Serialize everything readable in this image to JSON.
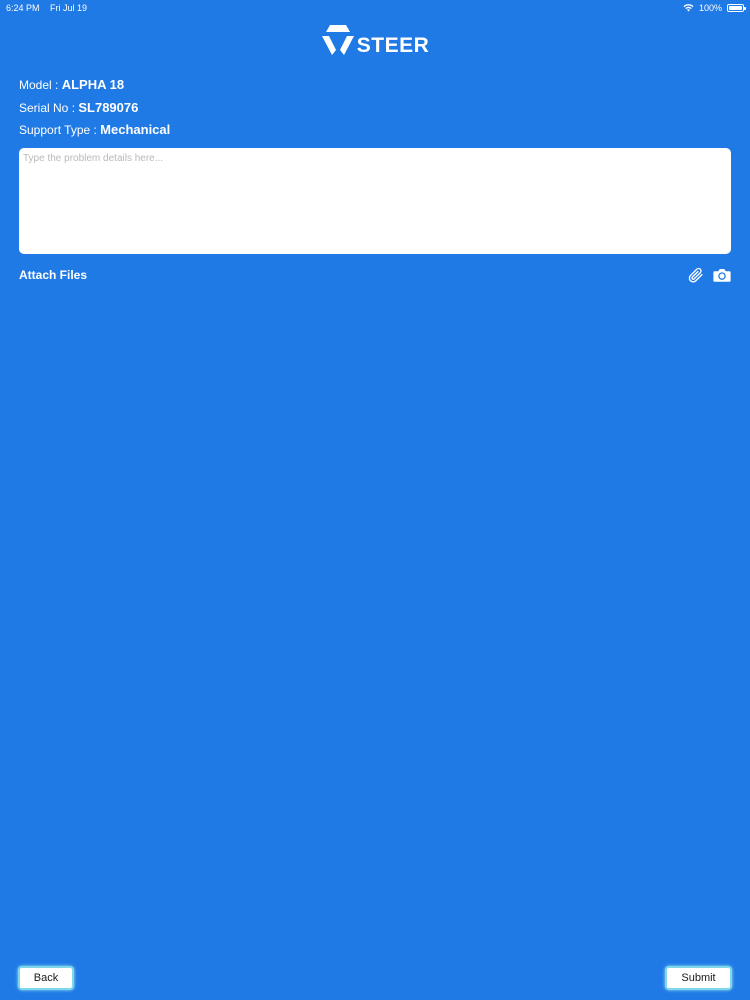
{
  "status_bar": {
    "time": "6:24 PM",
    "date": "Fri Jul 19",
    "battery": "100%",
    "battery_level": 1.0
  },
  "logo": {
    "text": "STEER"
  },
  "info": {
    "model_label": "Model : ",
    "model_value": "ALPHA 18",
    "serial_label": "Serial No : ",
    "serial_value": "SL789076",
    "support_label": "Support Type : ",
    "support_value": "Mechanical"
  },
  "problem": {
    "placeholder": "Type the problem details here...",
    "value": ""
  },
  "attach": {
    "label": "Attach Files",
    "icons": [
      "paperclip-icon",
      "camera-icon"
    ]
  },
  "buttons": {
    "back": "Back",
    "submit": "Submit"
  },
  "colors": {
    "background": "#1f7ae5",
    "button_glow": "#7fd8ea"
  }
}
